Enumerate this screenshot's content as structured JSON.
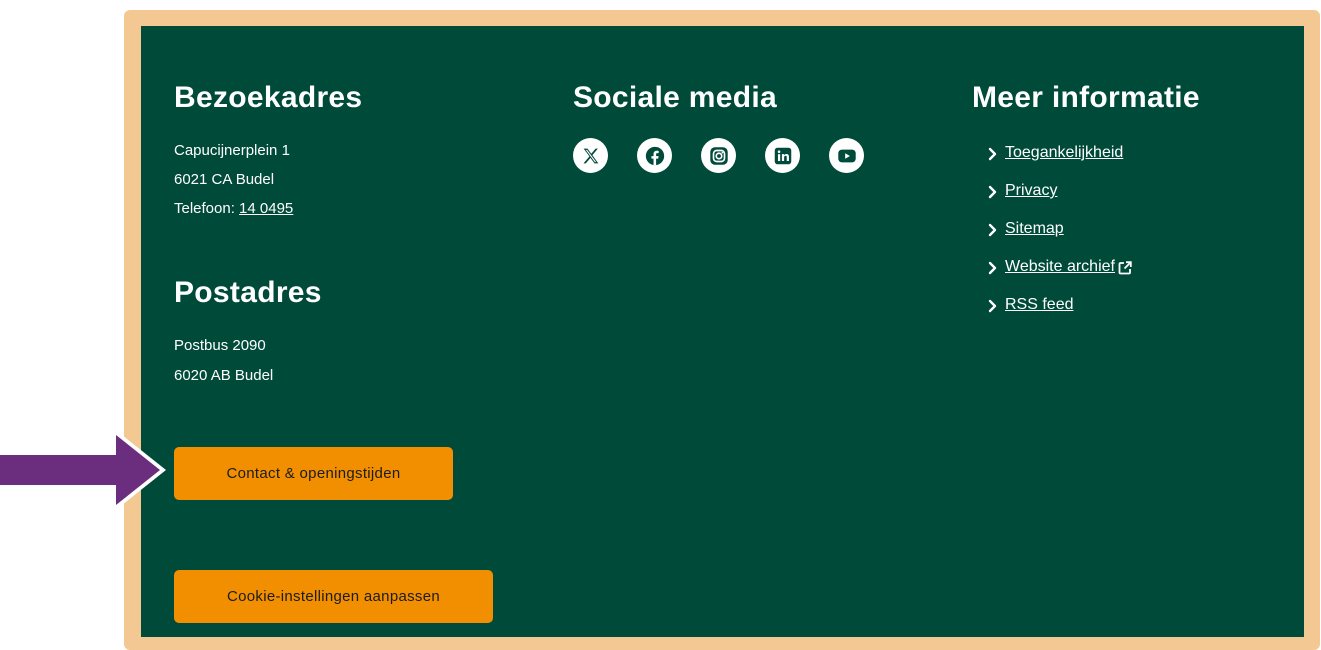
{
  "visit": {
    "heading": "Bezoekadres",
    "street": "Capucijnerplein 1",
    "postal": "6021 CA Budel",
    "phone_label": "Telefoon: ",
    "phone": "14 0495"
  },
  "postal": {
    "heading": "Postadres",
    "box": "Postbus 2090",
    "postal": "6020 AB Budel"
  },
  "social": {
    "heading": "Sociale media",
    "icons": [
      "x-icon",
      "facebook-icon",
      "instagram-icon",
      "linkedin-icon",
      "youtube-icon"
    ]
  },
  "info": {
    "heading": "Meer informatie",
    "links": [
      "Toegankelijkheid",
      "Privacy",
      "Sitemap",
      "Website archief",
      "RSS feed"
    ]
  },
  "buttons": {
    "contact": "Contact & openingstijden",
    "cookie": "Cookie-instellingen aanpassen"
  },
  "colors": {
    "footer_bg": "#004a3a",
    "frame": "#f3c893",
    "button": "#f28f00",
    "arrow": "#6b2d7d"
  }
}
